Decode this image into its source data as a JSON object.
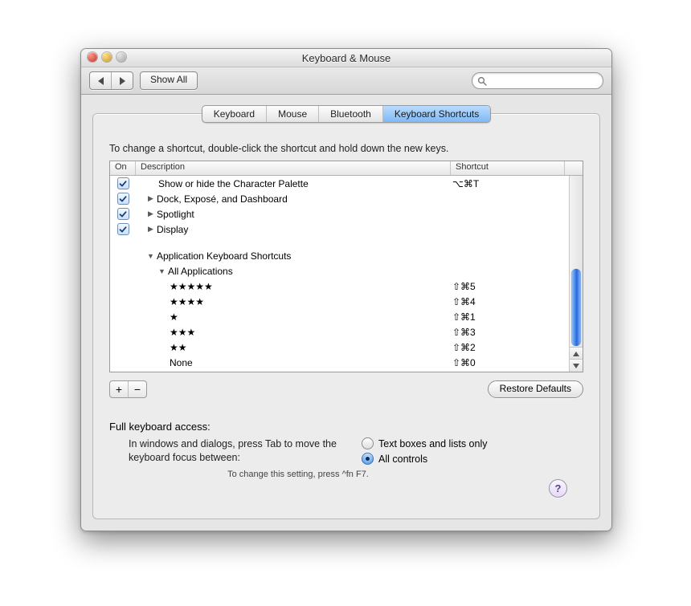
{
  "window": {
    "title": "Keyboard & Mouse"
  },
  "toolbar": {
    "show_all": "Show All",
    "search_placeholder": ""
  },
  "tabs": [
    {
      "label": "Keyboard",
      "active": false
    },
    {
      "label": "Mouse",
      "active": false
    },
    {
      "label": "Bluetooth",
      "active": false
    },
    {
      "label": "Keyboard Shortcuts",
      "active": true
    }
  ],
  "hint": "To change a shortcut, double-click the shortcut and hold down the new keys.",
  "columns": {
    "on": "On",
    "description": "Description",
    "shortcut": "Shortcut"
  },
  "rows": [
    {
      "type": "item",
      "checked": true,
      "indent": 2,
      "disclosure": "",
      "label": "Show or hide the Character Palette",
      "shortcut": "⌥⌘T"
    },
    {
      "type": "group",
      "checked": true,
      "indent": 1,
      "disclosure": "right",
      "label": "Dock, Exposé, and Dashboard",
      "shortcut": ""
    },
    {
      "type": "group",
      "checked": true,
      "indent": 1,
      "disclosure": "right",
      "label": "Spotlight",
      "shortcut": ""
    },
    {
      "type": "group",
      "checked": true,
      "indent": 1,
      "disclosure": "right",
      "label": "Display",
      "shortcut": ""
    },
    {
      "type": "spacer"
    },
    {
      "type": "group",
      "checked": null,
      "indent": 1,
      "disclosure": "down",
      "label": "Application Keyboard Shortcuts",
      "shortcut": ""
    },
    {
      "type": "group",
      "checked": null,
      "indent": 2,
      "disclosure": "down",
      "label": "All Applications",
      "shortcut": ""
    },
    {
      "type": "item",
      "checked": null,
      "indent": 3,
      "disclosure": "",
      "label": "★★★★★",
      "shortcut": "⇧⌘5"
    },
    {
      "type": "item",
      "checked": null,
      "indent": 3,
      "disclosure": "",
      "label": "★★★★",
      "shortcut": "⇧⌘4"
    },
    {
      "type": "item",
      "checked": null,
      "indent": 3,
      "disclosure": "",
      "label": "★",
      "shortcut": "⇧⌘1"
    },
    {
      "type": "item",
      "checked": null,
      "indent": 3,
      "disclosure": "",
      "label": "★★★",
      "shortcut": "⇧⌘3"
    },
    {
      "type": "item",
      "checked": null,
      "indent": 3,
      "disclosure": "",
      "label": "★★",
      "shortcut": "⇧⌘2"
    },
    {
      "type": "item",
      "checked": null,
      "indent": 3,
      "disclosure": "",
      "label": "None",
      "shortcut": "⇧⌘0"
    }
  ],
  "buttons": {
    "add": "+",
    "remove": "−",
    "restore_defaults": "Restore Defaults"
  },
  "access": {
    "heading": "Full keyboard access:",
    "desc": "In windows and dialogs, press Tab to move the keyboard focus between:",
    "option_text_only": "Text boxes and lists only",
    "option_all": "All controls",
    "selected": "all",
    "footer": "To change this setting, press ^fn F7."
  },
  "help_glyph": "?"
}
